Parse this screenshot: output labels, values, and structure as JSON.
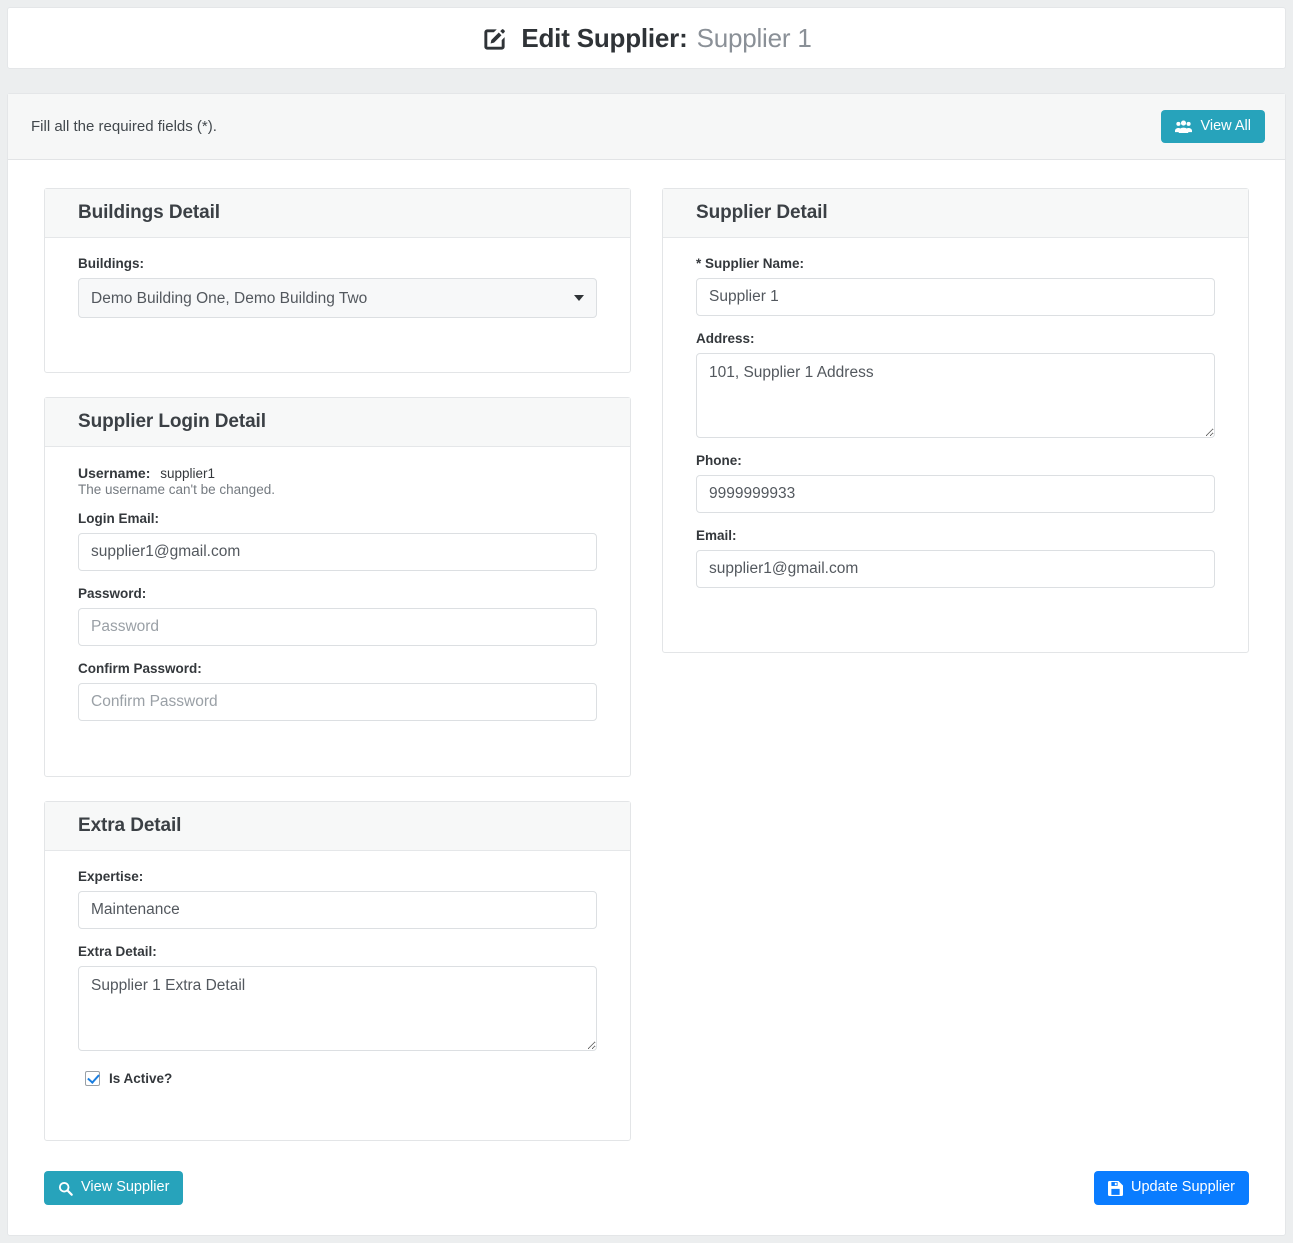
{
  "page": {
    "title_prefix": "Edit Supplier:",
    "title_suffix": "Supplier 1",
    "title_icon": "pen-to-square-icon"
  },
  "header": {
    "note": "Fill all the required fields (*).",
    "view_all_label": "View All",
    "view_all_icon": "users-icon"
  },
  "panels": {
    "buildings": {
      "heading": "Buildings Detail",
      "buildings_label": "Buildings:",
      "buildings_value": "Demo Building One, Demo Building Two"
    },
    "supplier": {
      "heading": "Supplier Detail",
      "name_label": "* Supplier Name:",
      "name_value": "Supplier 1",
      "address_label": "Address:",
      "address_value": "101, Supplier 1 Address",
      "phone_label": "Phone:",
      "phone_value": "9999999933",
      "email_label": "Email:",
      "email_value": "supplier1@gmail.com"
    },
    "login": {
      "heading": "Supplier Login Detail",
      "username_label": "Username:",
      "username_value": "supplier1",
      "username_help": "The username can't be changed.",
      "login_email_label": "Login Email:",
      "login_email_value": "supplier1@gmail.com",
      "password_label": "Password:",
      "password_placeholder": "Password",
      "password_value": "",
      "confirm_password_label": "Confirm Password:",
      "confirm_password_placeholder": "Confirm Password",
      "confirm_password_value": ""
    },
    "extra": {
      "heading": "Extra Detail",
      "expertise_label": "Expertise:",
      "expertise_value": "Maintenance",
      "extra_detail_label": "Extra Detail:",
      "extra_detail_value": "Supplier 1 Extra Detail",
      "is_active_label": "Is Active?",
      "is_active_checked": true
    }
  },
  "footer": {
    "view_supplier_label": "View Supplier",
    "view_supplier_icon": "search-icon",
    "update_supplier_label": "Update Supplier",
    "update_supplier_icon": "save-icon"
  },
  "colors": {
    "info": "#27a3bb",
    "primary": "#0a7cff",
    "page_background": "#eceeef",
    "panel_header": "#f7f8f8"
  }
}
